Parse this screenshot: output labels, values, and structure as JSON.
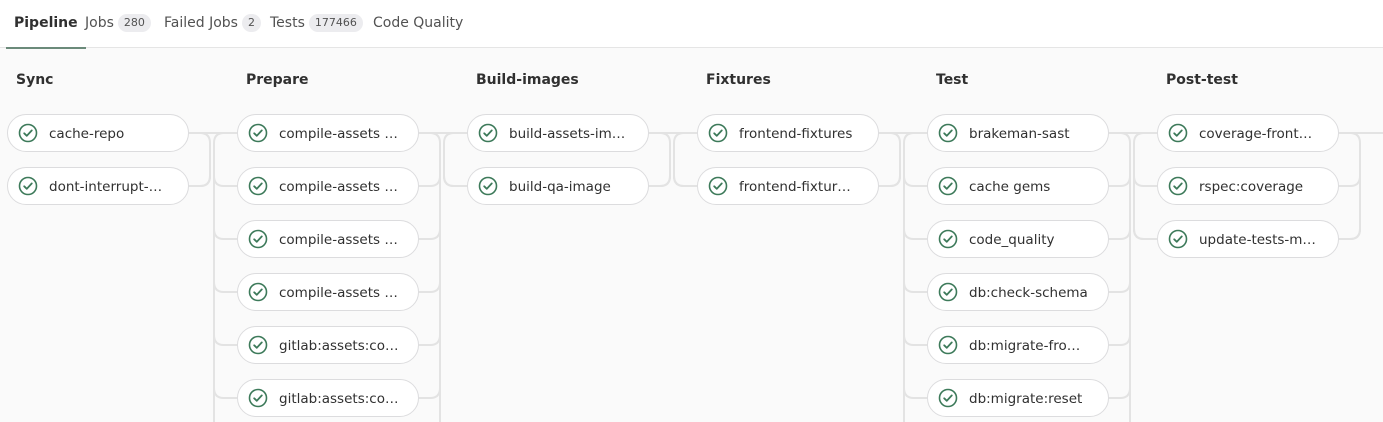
{
  "tabs": [
    {
      "label": "Pipeline",
      "count": null
    },
    {
      "label": "Jobs",
      "count": "280"
    },
    {
      "label": "Failed Jobs",
      "count": "2"
    },
    {
      "label": "Tests",
      "count": "177466"
    },
    {
      "label": "Code Quality",
      "count": null
    }
  ],
  "active_tab": "Pipeline",
  "status_icon": "check-circle-icon",
  "colors": {
    "success": "#3d7a5a",
    "connector": "#e3e3e3",
    "border": "#dcdcde"
  },
  "stages": [
    {
      "name": "Sync",
      "jobs": [
        {
          "name": "cache-repo",
          "status": "success"
        },
        {
          "name": "dont-interrupt-…",
          "status": "success"
        }
      ]
    },
    {
      "name": "Prepare",
      "jobs": [
        {
          "name": "compile-assets …",
          "status": "success"
        },
        {
          "name": "compile-assets …",
          "status": "success"
        },
        {
          "name": "compile-assets …",
          "status": "success"
        },
        {
          "name": "compile-assets …",
          "status": "success"
        },
        {
          "name": "gitlab:assets:co…",
          "status": "success"
        },
        {
          "name": "gitlab:assets:co…",
          "status": "success"
        }
      ]
    },
    {
      "name": "Build-images",
      "jobs": [
        {
          "name": "build-assets-im…",
          "status": "success"
        },
        {
          "name": "build-qa-image",
          "status": "success"
        }
      ]
    },
    {
      "name": "Fixtures",
      "jobs": [
        {
          "name": "frontend-fixtures",
          "status": "success"
        },
        {
          "name": "frontend-fixtur…",
          "status": "success"
        }
      ]
    },
    {
      "name": "Test",
      "jobs": [
        {
          "name": "brakeman-sast",
          "status": "success"
        },
        {
          "name": "cache gems",
          "status": "success"
        },
        {
          "name": "code_quality",
          "status": "success"
        },
        {
          "name": "db:check-schema",
          "status": "success"
        },
        {
          "name": "db:migrate-fro…",
          "status": "success"
        },
        {
          "name": "db:migrate:reset",
          "status": "success"
        }
      ]
    },
    {
      "name": "Post-test",
      "jobs": [
        {
          "name": "coverage-front…",
          "status": "success"
        },
        {
          "name": "rspec:coverage",
          "status": "success"
        },
        {
          "name": "update-tests-m…",
          "status": "success"
        }
      ]
    }
  ]
}
